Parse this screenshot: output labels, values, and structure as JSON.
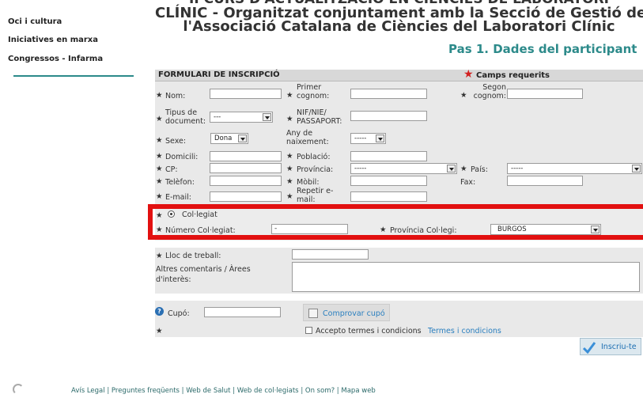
{
  "sidebar": {
    "items": [
      "Oci i cultura",
      "Iniciatives en marxa",
      "Congressos - Infarma"
    ]
  },
  "header": {
    "line0": "II CURS D'ACTUALITZACIÓ EN CIÈNCIES DE LABORATORI",
    "line1": "CLÍNIC - Organitzat conjuntament amb la Secció de Gestió de",
    "line2": "l'Associació Catalana de Ciències del Laboratori Clínic",
    "step": "Pas 1. Dades del participant"
  },
  "form": {
    "title": "FORMULARI DE INSCRIPCIÓ",
    "required_star": "★",
    "required_text": "Camps requerits",
    "labels": {
      "nom": "Nom:",
      "primer_cognom": "Primer cognom:",
      "segon_cognom": "Segon cognom:",
      "tipus_document": "Tipus de document:",
      "nif": "NIF/NIE/ PASSAPORT:",
      "sexe": "Sexe:",
      "any_naixement": "Any de naixement:",
      "domicili": "Domicili:",
      "poblacio": "Població:",
      "cp": "CP:",
      "provincia": "Província:",
      "pais": "País:",
      "telefon": "Telèfon:",
      "mobil": "Mòbil:",
      "fax": "Fax:",
      "email": "E-mail:",
      "repetir_email": "Repetir e-mail:",
      "collegiat": "Col·legiat",
      "numero_collegiat": "Número Col·legiat:",
      "provincia_collegi": "Província Col·legi:",
      "lloc_treball": "Lloc de treball:",
      "comentaris": "Altres comentaris / Àrees d'interès:",
      "cupo": "Cupó:",
      "accepto": "Accepto termes i condicions"
    },
    "values": {
      "tipus_document": "---",
      "sexe": "Dona",
      "any_naixement": "-----",
      "provincia": "-----",
      "pais": "-----",
      "numero_collegiat": "-",
      "provincia_collegi": "BURGOS"
    },
    "buttons": {
      "comprovar": "Comprovar cupó",
      "termes_link": "Termes i condicions",
      "submit": "Inscriu-te"
    }
  },
  "footer": {
    "links": [
      "Avís Legal",
      "Preguntes freqüents",
      "Web de Salut",
      "Web de col·legiats",
      "On som?",
      "Mapa web"
    ]
  },
  "colors": {
    "accent": "#2c8a8a",
    "required": "#d21f1f",
    "highlight_box": "#e21010",
    "link": "#2a7fbf"
  }
}
